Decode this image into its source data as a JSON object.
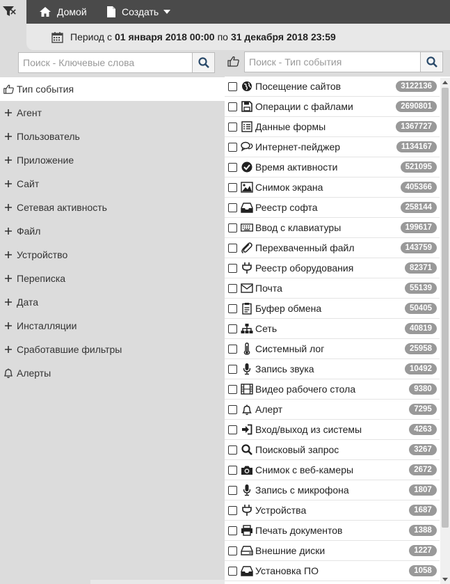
{
  "topbar": {
    "close_label": "×",
    "home_label": "Домой",
    "create_label": "Создать"
  },
  "period": {
    "prefix": "Период с",
    "from": "01 января 2018 00:00",
    "middle": "по",
    "to": "31 декабря 2018 23:59"
  },
  "left_search": {
    "placeholder": "Поиск - Ключевые слова"
  },
  "right_search": {
    "placeholder": "Поиск - Тип события"
  },
  "left_items": [
    {
      "label": "Тип события",
      "icon": "hand-point-icon"
    },
    {
      "label": "Агент",
      "icon": "plus-icon"
    },
    {
      "label": "Пользователь",
      "icon": "plus-icon"
    },
    {
      "label": "Приложение",
      "icon": "plus-icon"
    },
    {
      "label": "Сайт",
      "icon": "plus-icon"
    },
    {
      "label": "Сетевая активность",
      "icon": "plus-icon"
    },
    {
      "label": "Файл",
      "icon": "plus-icon"
    },
    {
      "label": "Устройство",
      "icon": "plus-icon"
    },
    {
      "label": "Переписка",
      "icon": "plus-icon"
    },
    {
      "label": "Дата",
      "icon": "plus-icon"
    },
    {
      "label": "Инсталляции",
      "icon": "plus-icon"
    },
    {
      "label": "Сработавшие фильтры",
      "icon": "plus-icon"
    },
    {
      "label": "Алерты",
      "icon": "bell-icon"
    }
  ],
  "events": [
    {
      "label": "Посещение сайтов",
      "count": "3122136",
      "icon": "globe-icon"
    },
    {
      "label": "Операции с файлами",
      "count": "2690801",
      "icon": "floppy-icon"
    },
    {
      "label": "Данные формы",
      "count": "1367727",
      "icon": "form-icon"
    },
    {
      "label": "Интернет-пейджер",
      "count": "1134167",
      "icon": "chat-icon"
    },
    {
      "label": "Время активности",
      "count": "521095",
      "icon": "check-circle-icon"
    },
    {
      "label": "Снимок экрана",
      "count": "405366",
      "icon": "image-icon"
    },
    {
      "label": "Реестр софта",
      "count": "258144",
      "icon": "inbox-icon"
    },
    {
      "label": "Ввод с клавиатуры",
      "count": "199617",
      "icon": "keyboard-icon"
    },
    {
      "label": "Перехваченный файл",
      "count": "143759",
      "icon": "paperclip-icon"
    },
    {
      "label": "Реестр оборудования",
      "count": "82371",
      "icon": "plug-icon"
    },
    {
      "label": "Почта",
      "count": "55139",
      "icon": "envelope-icon"
    },
    {
      "label": "Буфер обмена",
      "count": "50405",
      "icon": "clipboard-icon"
    },
    {
      "label": "Сеть",
      "count": "40819",
      "icon": "sitemap-icon"
    },
    {
      "label": "Системный лог",
      "count": "25958",
      "icon": "thermometer-icon"
    },
    {
      "label": "Запись звука",
      "count": "10492",
      "icon": "microphone-icon"
    },
    {
      "label": "Видео рабочего стола",
      "count": "9380",
      "icon": "film-icon"
    },
    {
      "label": "Алерт",
      "count": "7295",
      "icon": "bell-icon"
    },
    {
      "label": "Вход/выход из системы",
      "count": "4263",
      "icon": "sign-in-icon"
    },
    {
      "label": "Поисковый запрос",
      "count": "3267",
      "icon": "search-icon"
    },
    {
      "label": "Снимок с веб-камеры",
      "count": "2672",
      "icon": "camera-icon"
    },
    {
      "label": "Запись с микрофона",
      "count": "1807",
      "icon": "microphone-icon"
    },
    {
      "label": "Устройства",
      "count": "1687",
      "icon": "plug-icon"
    },
    {
      "label": "Печать документов",
      "count": "1388",
      "icon": "print-icon"
    },
    {
      "label": "Внешние диски",
      "count": "1227",
      "icon": "hdd-icon"
    },
    {
      "label": "Установка ПО",
      "count": "1058",
      "icon": "inbox-icon"
    }
  ]
}
